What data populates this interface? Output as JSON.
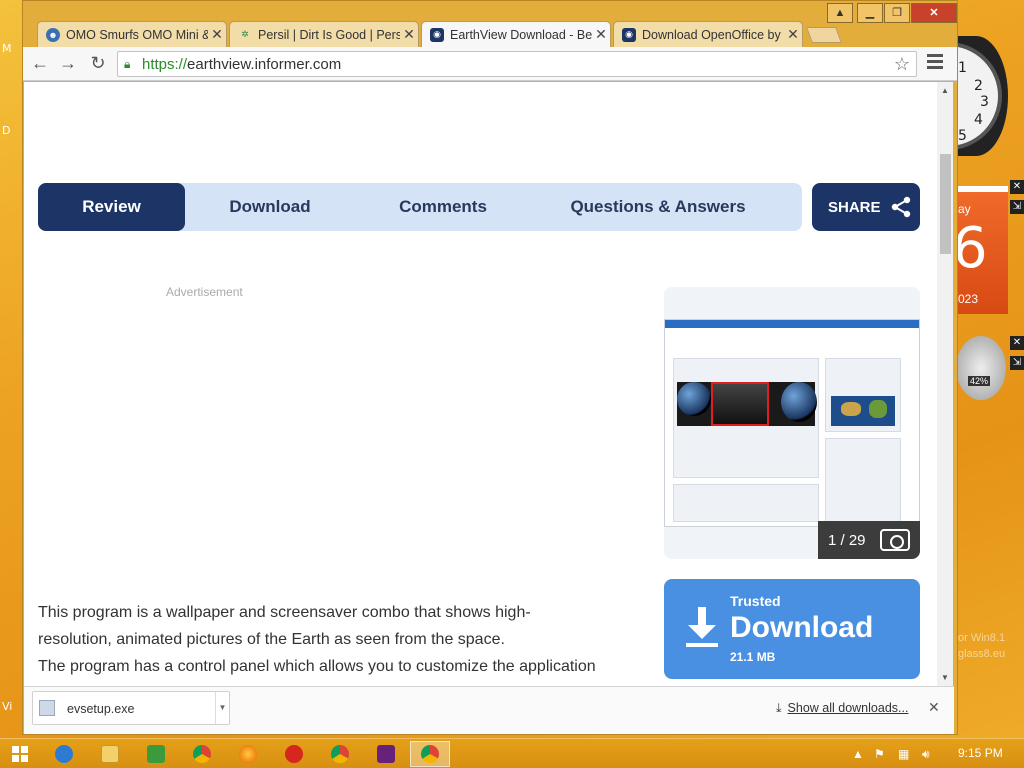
{
  "browser": {
    "tabs": [
      {
        "title": "OMO Smurfs OMO Mini &",
        "icon": "smurf-icon"
      },
      {
        "title": "Persil | Dirt Is Good | Persil",
        "icon": "persil-icon"
      },
      {
        "title": "EarthView Download - Be",
        "icon": "informer-icon"
      },
      {
        "title": "Download OpenOffice by",
        "icon": "informer-icon"
      }
    ],
    "url_scheme": "https://",
    "url_host": "earthview.informer.com"
  },
  "page": {
    "tabs": [
      "Review",
      "Download",
      "Comments",
      "Questions & Answers"
    ],
    "share_label": "SHARE",
    "ad_label": "Advertisement",
    "gallery_counter": "1 / 29",
    "download": {
      "trusted": "Trusted",
      "label": "Download",
      "size": "21.1 MB"
    },
    "description": [
      "This program is a wallpaper and screensaver combo that shows high-",
      "resolution, animated pictures of the Earth as seen from the space.",
      "The program has a control panel which allows you to customize the application"
    ]
  },
  "download_shelf": {
    "filename": "evsetup.exe",
    "show_all": "Show all downloads..."
  },
  "desktop": {
    "clock_numbers": [
      "1",
      "2",
      "3",
      "4",
      "5"
    ],
    "calendar_day": "ay",
    "calendar_num": "6",
    "calendar_year": "023",
    "cpu_pct": "42%",
    "watermark1": "or Win8.1",
    "watermark2": "glass8.eu",
    "left_labels": [
      "M",
      "D",
      "Vi"
    ]
  },
  "taskbar": {
    "time": "9:15 PM"
  }
}
